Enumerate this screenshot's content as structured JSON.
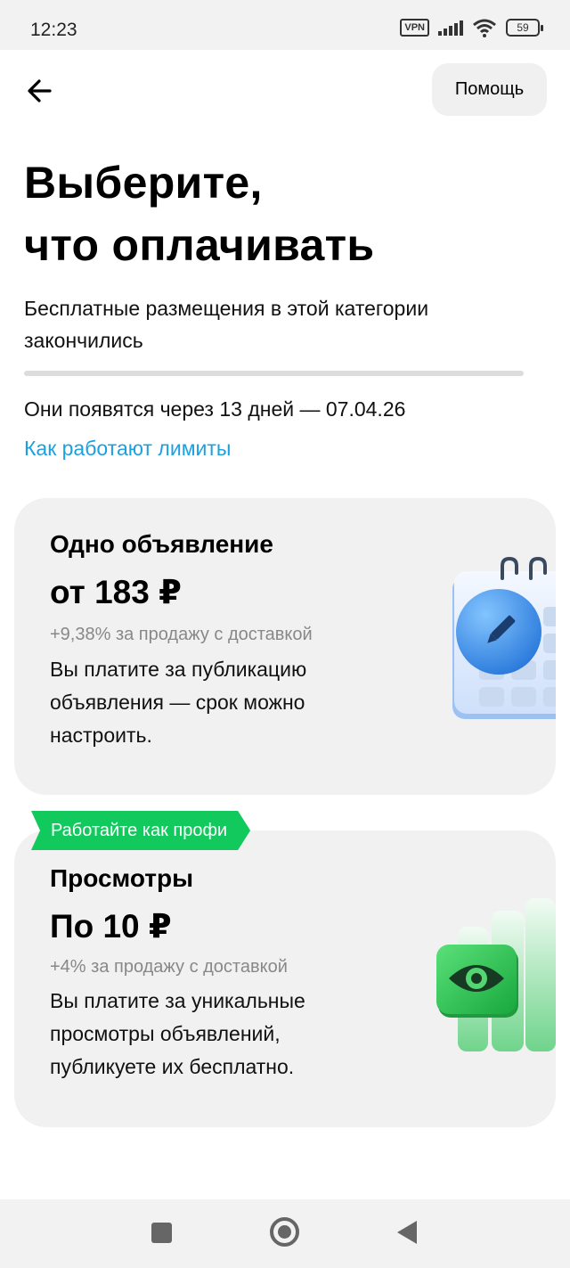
{
  "status_bar": {
    "time": "12:23",
    "vpn": "VPN",
    "battery": "59"
  },
  "header": {
    "help_label": "Помощь"
  },
  "page": {
    "title_line1": "Выберите,",
    "title_line2": "что оплачивать",
    "subtitle": "Бесплатные размещения в этой категории закончились",
    "appear_text": "Они появятся через 13 дней — 07.04.26",
    "limits_link": "Как работают лимиты"
  },
  "cards": [
    {
      "title": "Одно объявление",
      "price": "от 183 ₽",
      "fee": "+9,38% за продажу с доставкой",
      "description": "Вы платите за публикацию объявления — срок можно настроить."
    },
    {
      "badge": "Работайте как профи",
      "title": "Просмотры",
      "price": "По 10 ₽",
      "fee": "+4% за продажу с доставкой",
      "description": "Вы платите за уникальные просмотры объявлений, публикуете их бесплатно."
    }
  ],
  "colors": {
    "link": "#1ba0e1",
    "badge": "#12c95d",
    "card_bg": "#f1f1f1"
  }
}
